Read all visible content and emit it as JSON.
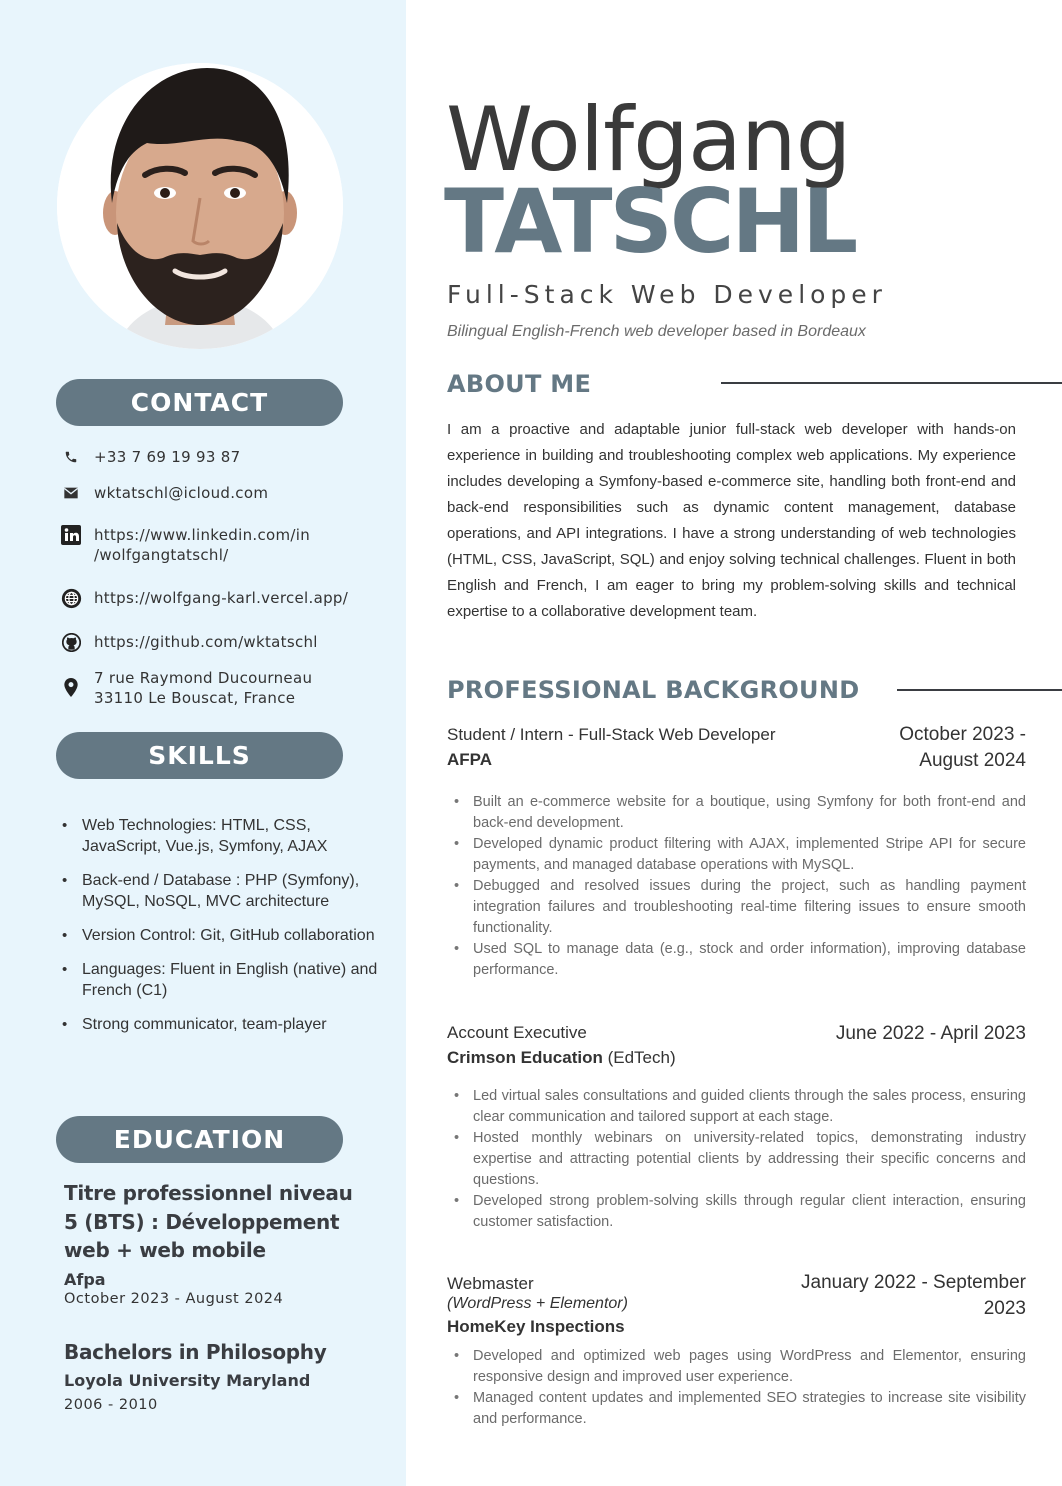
{
  "profile": {
    "first_name": "Wolfgang",
    "last_name": "TATSCHL",
    "job_title": "Full-Stack Web Developer",
    "tagline": "Bilingual English-French web developer based in Bordeaux"
  },
  "contact": {
    "heading": "CONTACT",
    "phone": "+33 7 69 19 93 87",
    "email": "wktatschl@icloud.com",
    "linkedin_line1": "https://www.linkedin.com/in",
    "linkedin_line2": "/wolfgangtatschl/",
    "website": "https://wolfgang-karl.vercel.app/",
    "github": "https://github.com/wktatschl",
    "address_line1": "7 rue Raymond Ducourneau",
    "address_line2": "33110 Le Bouscat, France",
    "icons": [
      "phone-icon",
      "mail-icon",
      "linkedin-icon",
      "globe-icon",
      "github-icon",
      "location-pin-icon"
    ]
  },
  "skills": {
    "heading": "SKILLS",
    "items": [
      "Web Technologies: HTML, CSS, JavaScript, Vue.js, Symfony, AJAX",
      "Back-end / Database : PHP (Symfony), MySQL, NoSQL, MVC architecture",
      "Version Control: Git, GitHub collaboration",
      "Languages: Fluent in English (native) and French (C1)",
      "Strong communicator, team-player"
    ]
  },
  "education": {
    "heading": "EDUCATION",
    "entries": [
      {
        "title": "Titre professionnel niveau 5 (BTS) : Développement web + web mobile",
        "school": "Afpa",
        "dates": "October 2023 - August 2024"
      },
      {
        "title": "Bachelors in Philosophy",
        "school": "Loyola University Maryland",
        "dates": "2006 - 2010"
      }
    ]
  },
  "about": {
    "heading": "ABOUT ME",
    "text": "I am a proactive and adaptable junior full-stack web developer with hands-on experience in building and troubleshooting complex web applications. My experience includes developing a Symfony-based e-commerce site, handling both front-end and back-end responsibilities such as dynamic content management, database operations, and API integrations. I have a strong understanding of web technologies (HTML, CSS, JavaScript, SQL) and enjoy solving technical challenges. Fluent in both English and French, I am eager to bring my problem-solving skills and technical expertise to a collaborative development team."
  },
  "background": {
    "heading": "PROFESSIONAL BACKGROUND",
    "jobs": [
      {
        "role": "Student / Intern - Full-Stack Web Developer",
        "company": "AFPA",
        "company_note": "",
        "dates_line1": "October 2023 -",
        "dates_line2": "August 2024",
        "bullets": [
          "Built an e-commerce website for a boutique, using Symfony for both front-end and back-end development.",
          "Developed dynamic product filtering with AJAX, implemented Stripe API for secure payments, and managed database operations with MySQL.",
          "Debugged and resolved issues during the project, such as handling payment integration failures and troubleshooting real-time filtering issues to ensure smooth functionality.",
          "Used SQL to manage data (e.g., stock and order information), improving database performance."
        ]
      },
      {
        "role": "Account Executive",
        "company": "Crimson Education",
        "company_note": " (EdTech)",
        "dates_line1": "June 2022 - April 2023",
        "dates_line2": "",
        "bullets": [
          "Led virtual sales consultations and guided clients through the sales process, ensuring clear communication and tailored support at each stage.",
          "Hosted monthly webinars on university-related topics, demonstrating industry expertise and attracting potential clients by addressing their specific concerns and questions.",
          "Developed strong problem-solving skills through regular client interaction, ensuring customer satisfaction."
        ]
      },
      {
        "role": "Webmaster",
        "subtitle": "(WordPress + Elementor)",
        "company": "HomeKey Inspections",
        "company_note": "",
        "dates_line1": "January 2022 - September",
        "dates_line2": "2023",
        "bullets": [
          "Developed and optimized web pages using WordPress and Elementor, ensuring responsive design and improved user experience.",
          "Managed content updates and implemented SEO strategies to increase site visibility and performance."
        ]
      }
    ]
  },
  "colors": {
    "accent": "#647884",
    "sidebar_bg": "#e8f5fc",
    "text": "#333333"
  }
}
